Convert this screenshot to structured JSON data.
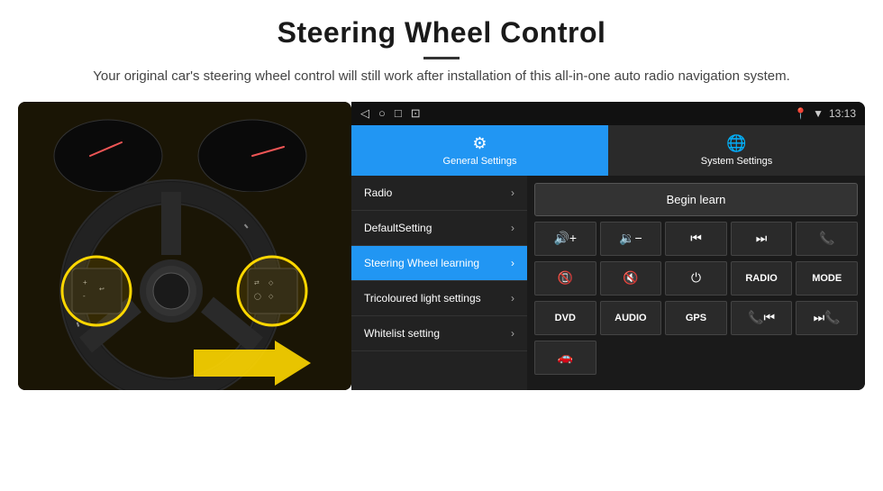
{
  "header": {
    "title": "Steering Wheel Control",
    "subtitle": "Your original car's steering wheel control will still work after installation of this all-in-one auto radio navigation system."
  },
  "tabs": [
    {
      "label": "General Settings",
      "icon": "⚙",
      "active": true
    },
    {
      "label": "System Settings",
      "icon": "🌐",
      "active": false
    }
  ],
  "status_bar": {
    "time": "13:13",
    "nav_icons": [
      "◁",
      "○",
      "□",
      "⊡"
    ]
  },
  "menu_items": [
    {
      "label": "Radio",
      "active": false
    },
    {
      "label": "DefaultSetting",
      "active": false
    },
    {
      "label": "Steering Wheel learning",
      "active": true
    },
    {
      "label": "Tricoloured light settings",
      "active": false
    },
    {
      "label": "Whitelist setting",
      "active": false
    }
  ],
  "begin_learn_label": "Begin learn",
  "control_buttons": {
    "row1": [
      {
        "label": "🔊+",
        "type": "icon"
      },
      {
        "label": "🔉-",
        "type": "icon"
      },
      {
        "label": "⏮",
        "type": "icon"
      },
      {
        "label": "⏭",
        "type": "icon"
      },
      {
        "label": "📞",
        "type": "icon"
      }
    ],
    "row2": [
      {
        "label": "📞",
        "type": "icon"
      },
      {
        "label": "🔇",
        "type": "icon"
      },
      {
        "label": "⏻",
        "type": "icon"
      },
      {
        "label": "RADIO",
        "type": "text"
      },
      {
        "label": "MODE",
        "type": "text"
      }
    ],
    "row3": [
      {
        "label": "DVD",
        "type": "text"
      },
      {
        "label": "AUDIO",
        "type": "text"
      },
      {
        "label": "GPS",
        "type": "text"
      },
      {
        "label": "📞⏮",
        "type": "icon"
      },
      {
        "label": "⏭📞",
        "type": "icon"
      }
    ]
  },
  "whitelist_icon": "🚗"
}
